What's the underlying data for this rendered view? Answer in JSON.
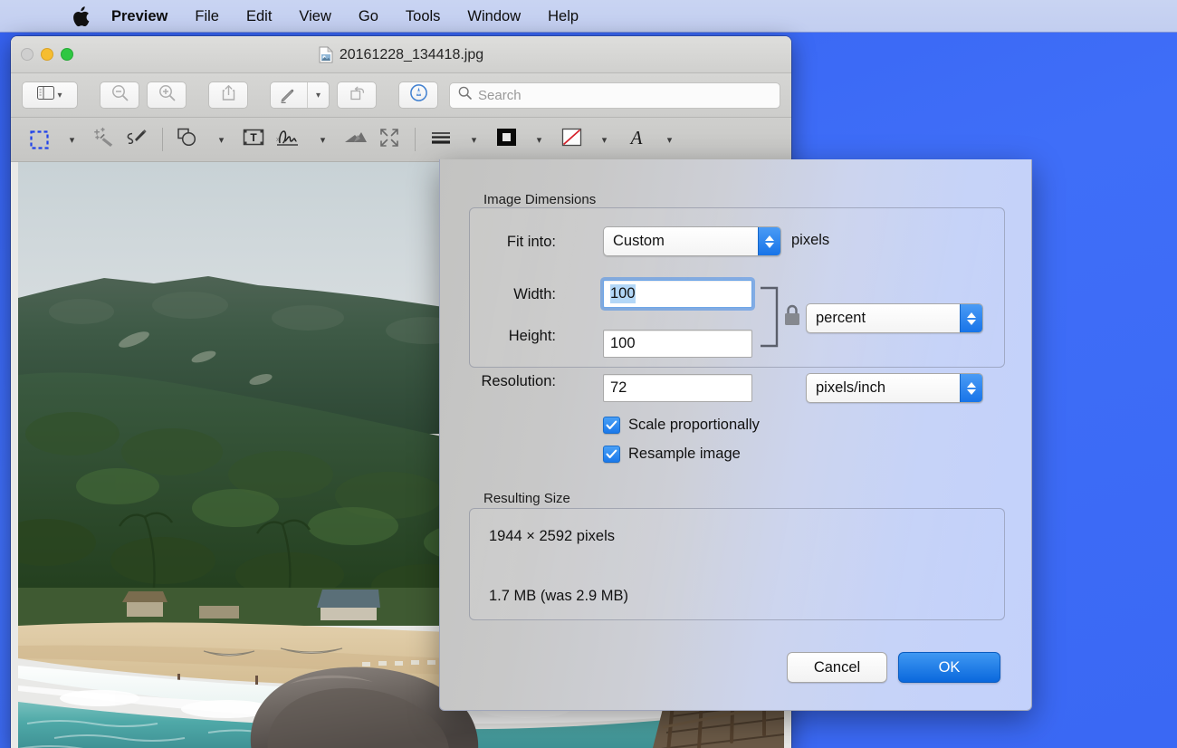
{
  "menubar": {
    "apple_icon": "apple-logo-icon",
    "items": [
      {
        "label": "Preview",
        "bold": true
      },
      {
        "label": "File",
        "bold": false
      },
      {
        "label": "Edit",
        "bold": false
      },
      {
        "label": "View",
        "bold": false
      },
      {
        "label": "Go",
        "bold": false
      },
      {
        "label": "Tools",
        "bold": false
      },
      {
        "label": "Window",
        "bold": false
      },
      {
        "label": "Help",
        "bold": false
      }
    ]
  },
  "window": {
    "title": "20161228_134418.jpg",
    "traffic_lights": {
      "close": "close-button",
      "minimize": "minimize-button",
      "zoom": "zoom-button"
    },
    "toolbar": {
      "sidebar": "sidebar-icon",
      "zoom_out": "zoom-out-icon",
      "zoom_in": "zoom-in-icon",
      "share": "share-icon",
      "markup": "markup-pen-icon",
      "rotate": "rotate-left-icon",
      "annotate": "annotate-icon"
    },
    "search": {
      "placeholder": "Search",
      "value": "",
      "icon": "search-icon"
    },
    "markup_tools": [
      {
        "name": "rectangular-selection",
        "icon": "dashed-rectangle-icon",
        "selected": true,
        "has_menu": true
      },
      {
        "name": "instant-alpha",
        "icon": "magic-wand-icon",
        "selected": false,
        "has_menu": false
      },
      {
        "name": "sketch",
        "icon": "sketch-pen-icon",
        "selected": false,
        "has_menu": false
      },
      {
        "name": "shapes",
        "icon": "shapes-icon",
        "selected": false,
        "has_menu": true
      },
      {
        "name": "text",
        "icon": "text-box-icon",
        "selected": false,
        "has_menu": false
      },
      {
        "name": "signature",
        "icon": "signature-icon",
        "selected": false,
        "has_menu": true
      },
      {
        "name": "adjust-color",
        "icon": "adjust-color-icon",
        "selected": false,
        "has_menu": false
      },
      {
        "name": "adjust-size",
        "icon": "adjust-size-icon",
        "selected": false,
        "has_menu": false
      },
      {
        "name": "shape-style",
        "icon": "stroke-weight-icon",
        "selected": false,
        "has_menu": true
      },
      {
        "name": "border-color",
        "icon": "fill-swatch-icon",
        "selected": false,
        "has_menu": true
      },
      {
        "name": "fill-color",
        "icon": "no-fill-swatch-icon",
        "selected": false,
        "has_menu": true
      },
      {
        "name": "text-style",
        "icon": "font-A-icon",
        "selected": false,
        "has_menu": true
      }
    ]
  },
  "dialog": {
    "image_dimensions": {
      "group_label": "Image Dimensions",
      "fit_into_label": "Fit into:",
      "fit_into_value": "Custom",
      "fit_into_unit": "pixels",
      "width_label": "Width:",
      "width_value": "100",
      "width_focused": true,
      "height_label": "Height:",
      "height_value": "100",
      "size_unit_value": "percent",
      "resolution_label": "Resolution:",
      "resolution_value": "72",
      "resolution_unit_value": "pixels/inch",
      "link_icon": "lock-closed-icon",
      "scale_proportionally_label": "Scale proportionally",
      "scale_proportionally_checked": true,
      "resample_image_label": "Resample image",
      "resample_image_checked": true
    },
    "resulting_size": {
      "group_label": "Resulting Size",
      "dimensions": "1944 × 2592 pixels",
      "filesize": "1.7 MB (was 2.9 MB)"
    },
    "buttons": {
      "cancel": "Cancel",
      "ok": "OK"
    }
  },
  "colors": {
    "desktop": "#3a68f4",
    "menubar": "#c6d1f1",
    "accent_blue": "#1a78ea",
    "default_button": "#1874e8",
    "selection_highlight": "#b3d7f7",
    "minimize": "#f6bd30",
    "zoom": "#2fc742"
  }
}
